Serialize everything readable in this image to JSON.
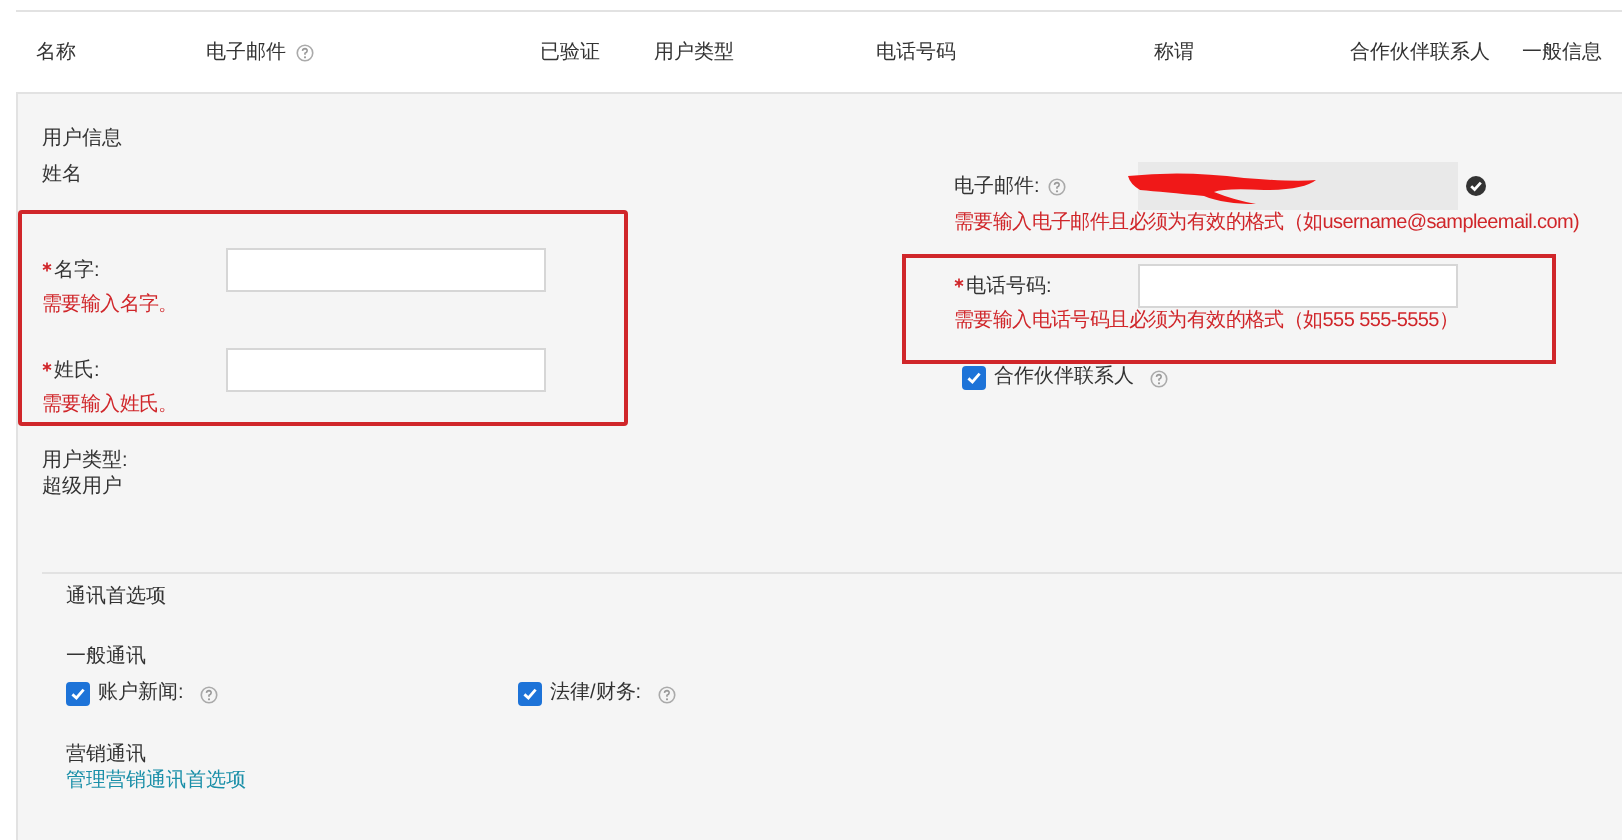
{
  "table": {
    "columns": [
      {
        "label": "名称"
      },
      {
        "label": "电子邮件",
        "help": true
      },
      {
        "label": "已验证"
      },
      {
        "label": "用户类型"
      },
      {
        "label": "电话号码"
      },
      {
        "label": "称谓"
      },
      {
        "label": "合作伙伴联系人"
      },
      {
        "label": "一般信息"
      }
    ]
  },
  "user_info": {
    "title": "用户信息",
    "name_label": "姓名",
    "name_fields": {
      "highlighted": true,
      "fields": [
        {
          "label": "名字:",
          "required": true,
          "error": "需要输入名字。"
        },
        {
          "label": "姓氏:",
          "required": true,
          "error": "需要输入姓氏。"
        }
      ]
    },
    "user_type_label": "用户类型:",
    "user_type": "超级用户"
  },
  "email": {
    "label": "电子邮件:",
    "help": true,
    "redacted": true,
    "verified": true,
    "error": "需要输入电子邮件且必须为有效的格式（如username@sampleemail.com)"
  },
  "phone": {
    "highlighted": true,
    "label": "电话号码:",
    "required": true,
    "error": "需要输入电话号码且必须为有效的格式（如555 555-5555）"
  },
  "partner_contact": {
    "label": "合作伙伴联系人",
    "checked": true,
    "help": true
  },
  "communication": {
    "title": "通讯首选项",
    "general": {
      "title": "一般通讯",
      "options": [
        {
          "label": "账户新闻:",
          "checked": true,
          "help": true
        },
        {
          "label": "法律/财务:",
          "checked": true,
          "help": true
        }
      ]
    },
    "marketing": {
      "title": "营销通讯",
      "link": "管理营销通讯首选项"
    }
  }
}
